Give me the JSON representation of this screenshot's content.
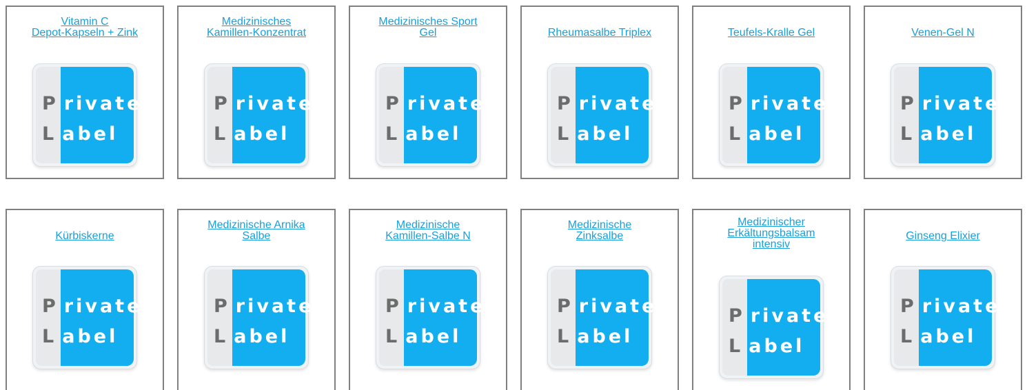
{
  "brand": {
    "logo_line1_cap": "P",
    "logo_line1_rest": "rivate",
    "logo_line2_cap": "L",
    "logo_line2_rest": "abel",
    "logo_blue": "#12aeef",
    "logo_grey": "#e8e9ea",
    "link_color": "#1a9fd9",
    "border_color": "#7f7f7f"
  },
  "products": [
    {
      "title_lines": [
        "Vitamin C",
        "Depot-Kapseln + Zink"
      ]
    },
    {
      "title_lines": [
        "Medizinisches",
        "Kamillen-Konzentrat"
      ]
    },
    {
      "title_lines": [
        "Medizinisches Sport",
        "Gel"
      ]
    },
    {
      "title_lines": [
        "Rheumasalbe Triplex"
      ]
    },
    {
      "title_lines": [
        "Teufels-Kralle Gel"
      ]
    },
    {
      "title_lines": [
        "Venen-Gel N"
      ]
    },
    {
      "title_lines": [
        "Kürbiskerne"
      ]
    },
    {
      "title_lines": [
        "Medizinische Arnika",
        "Salbe"
      ]
    },
    {
      "title_lines": [
        "Medizinische",
        "Kamillen-Salbe N"
      ]
    },
    {
      "title_lines": [
        "Medizinische",
        "Zinksalbe"
      ]
    },
    {
      "title_lines": [
        "Medizinischer",
        "Erkältungsbalsam",
        "intensiv"
      ]
    },
    {
      "title_lines": [
        "Ginseng Elixier"
      ]
    }
  ]
}
